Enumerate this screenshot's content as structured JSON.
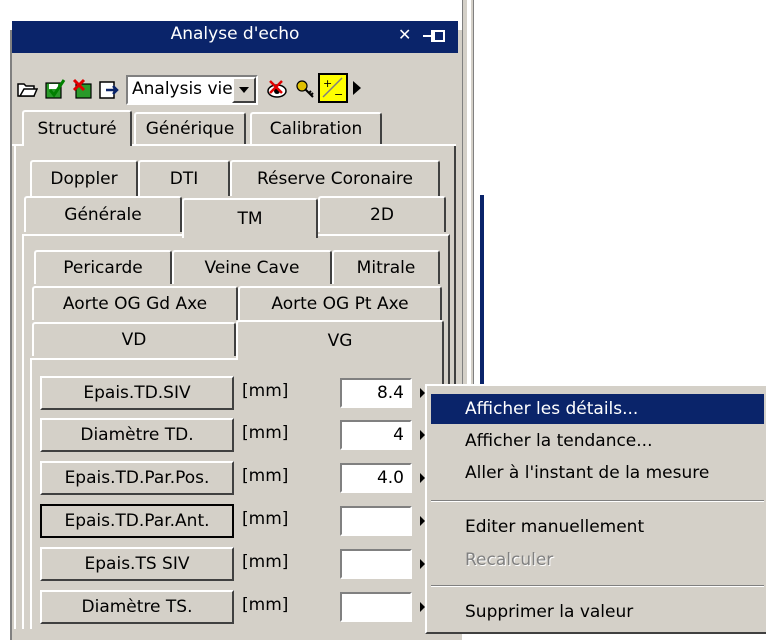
{
  "window": {
    "title": "Analyse d'echo",
    "close_glyph": "✕",
    "pin_glyph": "⊣⊢"
  },
  "toolbar": {
    "icons": [
      "open-folder-icon",
      "save-check-icon",
      "delete-icon",
      "export-icon",
      "eye-icon",
      "key-icon",
      "compute-icon",
      "more-arrow-icon"
    ],
    "view_select": {
      "value": "Analysis vie"
    }
  },
  "tabs_level1": [
    "Structuré",
    "Générique",
    "Calibration"
  ],
  "tabs_level2_row1": [
    "Doppler",
    "DTI",
    "Réserve Coronaire"
  ],
  "tabs_level2_row2": [
    "Générale",
    "TM",
    "2D"
  ],
  "tabs_level3_row1": [
    "Pericarde",
    "Veine Cave",
    "Mitrale"
  ],
  "tabs_level3_row2": [
    "Aorte OG Gd Axe",
    "Aorte OG Pt Axe"
  ],
  "tabs_level3_row3": [
    "VD",
    "VG"
  ],
  "measurements": [
    {
      "label": "Epais.TD.SIV",
      "unit": "[mm]",
      "value": "8.4"
    },
    {
      "label": "Diamètre TD.",
      "unit": "[mm]",
      "value": "4"
    },
    {
      "label": "Epais.TD.Par.Pos.",
      "unit": "[mm]",
      "value": "4.0"
    },
    {
      "label": "Epais.TD.Par.Ant.",
      "unit": "[mm]",
      "value": ""
    },
    {
      "label": "Epais.TS SIV",
      "unit": "[mm]",
      "value": ""
    },
    {
      "label": "Diamètre TS.",
      "unit": "[mm]",
      "value": ""
    }
  ],
  "context_menu": {
    "items": [
      {
        "label": "Afficher les détails...",
        "highlighted": true,
        "enabled": true
      },
      {
        "label": "Afficher la tendance...",
        "highlighted": false,
        "enabled": true
      },
      {
        "label": "Aller à l'instant de la mesure",
        "highlighted": false,
        "enabled": true
      },
      {
        "label": "Editer manuellement",
        "highlighted": false,
        "enabled": true
      },
      {
        "label": "Recalculer",
        "highlighted": false,
        "enabled": false
      },
      {
        "label": "Supprimer la valeur",
        "highlighted": false,
        "enabled": true
      }
    ]
  },
  "colors": {
    "titlebar": "#0a246a",
    "face": "#d4d0c8",
    "highlight": "#0a246a",
    "scrollbar_accent": "#0a246a"
  }
}
